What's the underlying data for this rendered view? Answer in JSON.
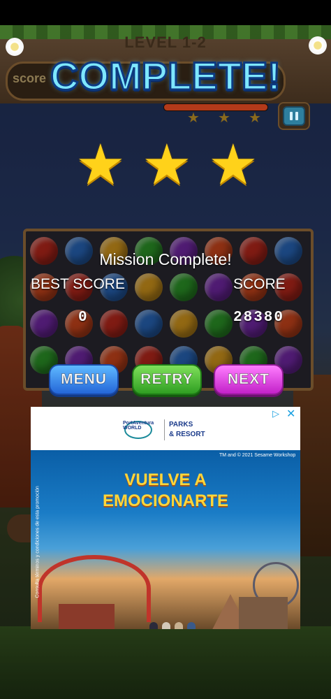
{
  "level_title": "LEVEL  1-2",
  "score_label": "score",
  "banner": "COMPLETE!",
  "stars_earned": 3,
  "progress_fraction": 1.0,
  "mission_title": "Mission Complete!",
  "best_score_label": "BEST SCORE",
  "score_label_right": "SCORE",
  "best_score_value": "0",
  "score_value": "28380",
  "buttons": {
    "menu": "MENU",
    "retry": "RETRY",
    "next": "NEXT"
  },
  "icons": {
    "star": "star-icon",
    "pause": "pause-icon",
    "ad_choices": "ad-choices-icon",
    "close": "close-icon"
  },
  "ad": {
    "brand": "PortAventura WORLD",
    "parks_line1": "PARKS",
    "parks_line2": "& RESORT",
    "copyright": "TM and © 2021 Sesame Workshop",
    "headline_line1": "VUELVE A",
    "headline_line2": "EMOCIONARTE",
    "legal": "Consulta términos y condiciones de esta promoción"
  },
  "colors": {
    "banner_text": "#7ee7ff",
    "star": "#ffd21a",
    "menu_button": "#2466d8",
    "retry_button": "#2f9e22",
    "next_button": "#c221c8",
    "ad_headline": "#ffd63a"
  }
}
